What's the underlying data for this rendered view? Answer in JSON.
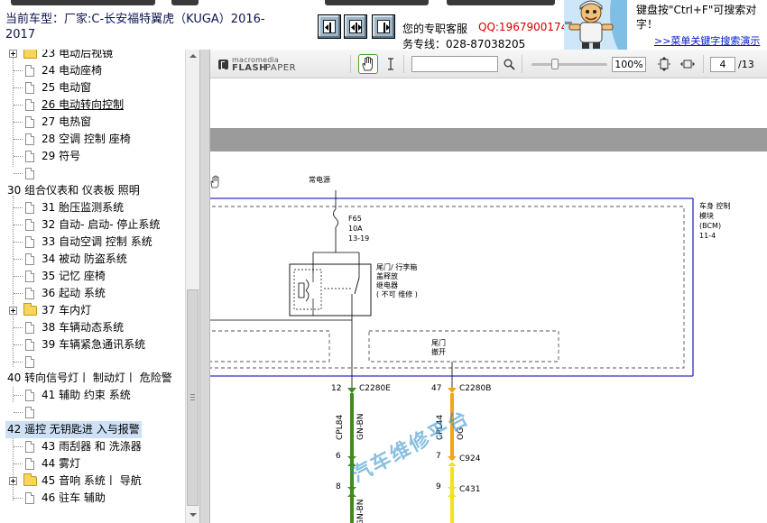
{
  "header": {
    "car_model": "当前车型：厂家:C-长安福特翼虎（KUGA）2016-2017",
    "contact_line_1": "您的专职客服",
    "qq": "QQ:1967900174",
    "contact_line_2": "务专线：028-87038205",
    "search_hint": "键盘按\"Ctrl+F\"可搜索对\n字！",
    "search_hint_link": ">>菜单关键字搜索演示"
  },
  "tree": {
    "items": [
      {
        "label": "23 电动后视镜"
      },
      {
        "label": "24 电动座椅"
      },
      {
        "label": "25 电动窗"
      },
      {
        "label": "26 电动转向控制"
      },
      {
        "label": "27 电热窗"
      },
      {
        "label": "28 空调 控制 座椅"
      },
      {
        "label": "29 符号"
      },
      {
        "label": "30 组合仪表和 仪表板 照明"
      },
      {
        "label": "31 胎压监测系统"
      },
      {
        "label": "32 自动- 启动- 停止系统"
      },
      {
        "label": "33 自动空调 控制 系统"
      },
      {
        "label": "34 被动 防盗系统"
      },
      {
        "label": "35 记忆 座椅"
      },
      {
        "label": "36 起动 系统"
      },
      {
        "label": "37 车内灯"
      },
      {
        "label": "38 车辆动态系统"
      },
      {
        "label": "39 车辆紧急通讯系统"
      },
      {
        "label": "40 转向信号灯丨 制动灯丨 危险警"
      },
      {
        "label": "41 辅助 约束 系统"
      },
      {
        "label": "42 遥控 无钥匙进 入与报警"
      },
      {
        "label": "43 雨刮器 和 洗涤器"
      },
      {
        "label": "44 雾灯"
      },
      {
        "label": "45 音响 系统丨 导航"
      },
      {
        "label": "46 驻车 辅助"
      }
    ]
  },
  "viewer": {
    "brand_line_1": "macromedia",
    "brand_line_2": "FLASH",
    "brand_line_3": "PAPER",
    "zoom": "100%",
    "page": "4",
    "page_total": "/13"
  },
  "diagram": {
    "power_label": "常电源",
    "fuse_id": "F65",
    "fuse_rating": "10A",
    "fuse_ref": "13-19",
    "bcm_label": "车身 控制\n模块\n(BCM)\n11-4",
    "relay_label": "尾门/ 行李箱\n盖释放\n继电器\n( 不可 维修 )",
    "tailgate_label": "尾门\n撤开",
    "pin_left": "12",
    "pin_right": "47",
    "conn_left": "C2280E",
    "conn_right": "C2280B",
    "circuit_left": "CPL84",
    "wire_left": "GN-BN",
    "circuit_right": "CPL44",
    "wire_right": "OG",
    "pin_6": "6",
    "pin_7": "7",
    "conn_c924": "C924",
    "pin_8": "8",
    "pin_9": "9",
    "conn_c431": "C431",
    "wire_left_2": "GN-BN",
    "watermark": "汽车维修平台",
    "colors": {
      "green_wire": "#3f8b1f",
      "orange_wire": "#f2a41a",
      "yellow_wire": "#f0e21f",
      "module_border": "#2d2dc8"
    }
  }
}
